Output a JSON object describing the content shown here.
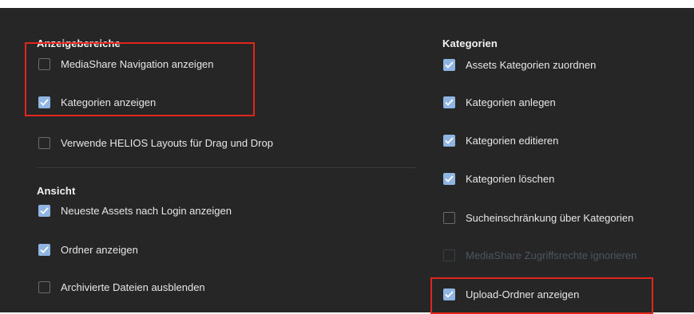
{
  "left": {
    "display_section": {
      "title": "Anzeigebereiche",
      "options": [
        {
          "label": "MediaShare Navigation anzeigen",
          "checked": false
        },
        {
          "label": "Kategorien anzeigen",
          "checked": true
        },
        {
          "label": "Verwende HELIOS Layouts für Drag und Drop",
          "checked": false
        }
      ]
    },
    "view_section": {
      "title": "Ansicht",
      "options": [
        {
          "label": "Neueste Assets nach Login anzeigen",
          "checked": true
        },
        {
          "label": "Ordner anzeigen",
          "checked": true
        },
        {
          "label": "Archivierte Dateien ausblenden",
          "checked": false
        }
      ]
    }
  },
  "right": {
    "categories_section": {
      "title": "Kategorien",
      "options": [
        {
          "label": "Assets Kategorien zuordnen",
          "checked": true
        },
        {
          "label": "Kategorien anlegen",
          "checked": true
        },
        {
          "label": "Kategorien editieren",
          "checked": true
        },
        {
          "label": "Kategorien löschen",
          "checked": true
        },
        {
          "label": "Sucheinschränkung über Kategorien",
          "checked": false
        },
        {
          "label": "MediaShare Zugriffsrechte ignorieren",
          "checked": false,
          "disabled": true
        },
        {
          "label": "Upload-Ordner anzeigen",
          "checked": true
        }
      ]
    }
  },
  "colors": {
    "panel_bg": "#262626",
    "checkbox_checked": "#8fb6e2",
    "highlight": "#e0261b"
  }
}
